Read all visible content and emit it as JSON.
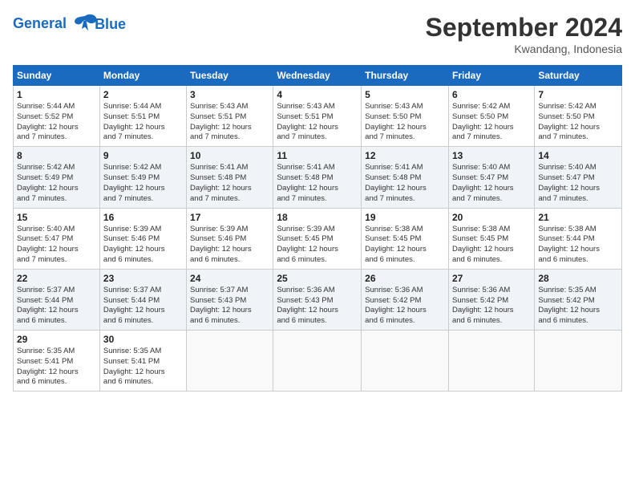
{
  "logo": {
    "line1": "General",
    "line2": "Blue"
  },
  "title": "September 2024",
  "location": "Kwandang, Indonesia",
  "days_of_week": [
    "Sunday",
    "Monday",
    "Tuesday",
    "Wednesday",
    "Thursday",
    "Friday",
    "Saturday"
  ],
  "weeks": [
    [
      {
        "day": "1",
        "info": "Sunrise: 5:44 AM\nSunset: 5:52 PM\nDaylight: 12 hours\nand 7 minutes."
      },
      {
        "day": "2",
        "info": "Sunrise: 5:44 AM\nSunset: 5:51 PM\nDaylight: 12 hours\nand 7 minutes."
      },
      {
        "day": "3",
        "info": "Sunrise: 5:43 AM\nSunset: 5:51 PM\nDaylight: 12 hours\nand 7 minutes."
      },
      {
        "day": "4",
        "info": "Sunrise: 5:43 AM\nSunset: 5:51 PM\nDaylight: 12 hours\nand 7 minutes."
      },
      {
        "day": "5",
        "info": "Sunrise: 5:43 AM\nSunset: 5:50 PM\nDaylight: 12 hours\nand 7 minutes."
      },
      {
        "day": "6",
        "info": "Sunrise: 5:42 AM\nSunset: 5:50 PM\nDaylight: 12 hours\nand 7 minutes."
      },
      {
        "day": "7",
        "info": "Sunrise: 5:42 AM\nSunset: 5:50 PM\nDaylight: 12 hours\nand 7 minutes."
      }
    ],
    [
      {
        "day": "8",
        "info": "Sunrise: 5:42 AM\nSunset: 5:49 PM\nDaylight: 12 hours\nand 7 minutes."
      },
      {
        "day": "9",
        "info": "Sunrise: 5:42 AM\nSunset: 5:49 PM\nDaylight: 12 hours\nand 7 minutes."
      },
      {
        "day": "10",
        "info": "Sunrise: 5:41 AM\nSunset: 5:48 PM\nDaylight: 12 hours\nand 7 minutes."
      },
      {
        "day": "11",
        "info": "Sunrise: 5:41 AM\nSunset: 5:48 PM\nDaylight: 12 hours\nand 7 minutes."
      },
      {
        "day": "12",
        "info": "Sunrise: 5:41 AM\nSunset: 5:48 PM\nDaylight: 12 hours\nand 7 minutes."
      },
      {
        "day": "13",
        "info": "Sunrise: 5:40 AM\nSunset: 5:47 PM\nDaylight: 12 hours\nand 7 minutes."
      },
      {
        "day": "14",
        "info": "Sunrise: 5:40 AM\nSunset: 5:47 PM\nDaylight: 12 hours\nand 7 minutes."
      }
    ],
    [
      {
        "day": "15",
        "info": "Sunrise: 5:40 AM\nSunset: 5:47 PM\nDaylight: 12 hours\nand 7 minutes."
      },
      {
        "day": "16",
        "info": "Sunrise: 5:39 AM\nSunset: 5:46 PM\nDaylight: 12 hours\nand 6 minutes."
      },
      {
        "day": "17",
        "info": "Sunrise: 5:39 AM\nSunset: 5:46 PM\nDaylight: 12 hours\nand 6 minutes."
      },
      {
        "day": "18",
        "info": "Sunrise: 5:39 AM\nSunset: 5:45 PM\nDaylight: 12 hours\nand 6 minutes."
      },
      {
        "day": "19",
        "info": "Sunrise: 5:38 AM\nSunset: 5:45 PM\nDaylight: 12 hours\nand 6 minutes."
      },
      {
        "day": "20",
        "info": "Sunrise: 5:38 AM\nSunset: 5:45 PM\nDaylight: 12 hours\nand 6 minutes."
      },
      {
        "day": "21",
        "info": "Sunrise: 5:38 AM\nSunset: 5:44 PM\nDaylight: 12 hours\nand 6 minutes."
      }
    ],
    [
      {
        "day": "22",
        "info": "Sunrise: 5:37 AM\nSunset: 5:44 PM\nDaylight: 12 hours\nand 6 minutes."
      },
      {
        "day": "23",
        "info": "Sunrise: 5:37 AM\nSunset: 5:44 PM\nDaylight: 12 hours\nand 6 minutes."
      },
      {
        "day": "24",
        "info": "Sunrise: 5:37 AM\nSunset: 5:43 PM\nDaylight: 12 hours\nand 6 minutes."
      },
      {
        "day": "25",
        "info": "Sunrise: 5:36 AM\nSunset: 5:43 PM\nDaylight: 12 hours\nand 6 minutes."
      },
      {
        "day": "26",
        "info": "Sunrise: 5:36 AM\nSunset: 5:42 PM\nDaylight: 12 hours\nand 6 minutes."
      },
      {
        "day": "27",
        "info": "Sunrise: 5:36 AM\nSunset: 5:42 PM\nDaylight: 12 hours\nand 6 minutes."
      },
      {
        "day": "28",
        "info": "Sunrise: 5:35 AM\nSunset: 5:42 PM\nDaylight: 12 hours\nand 6 minutes."
      }
    ],
    [
      {
        "day": "29",
        "info": "Sunrise: 5:35 AM\nSunset: 5:41 PM\nDaylight: 12 hours\nand 6 minutes."
      },
      {
        "day": "30",
        "info": "Sunrise: 5:35 AM\nSunset: 5:41 PM\nDaylight: 12 hours\nand 6 minutes."
      },
      {
        "day": "",
        "info": ""
      },
      {
        "day": "",
        "info": ""
      },
      {
        "day": "",
        "info": ""
      },
      {
        "day": "",
        "info": ""
      },
      {
        "day": "",
        "info": ""
      }
    ]
  ]
}
